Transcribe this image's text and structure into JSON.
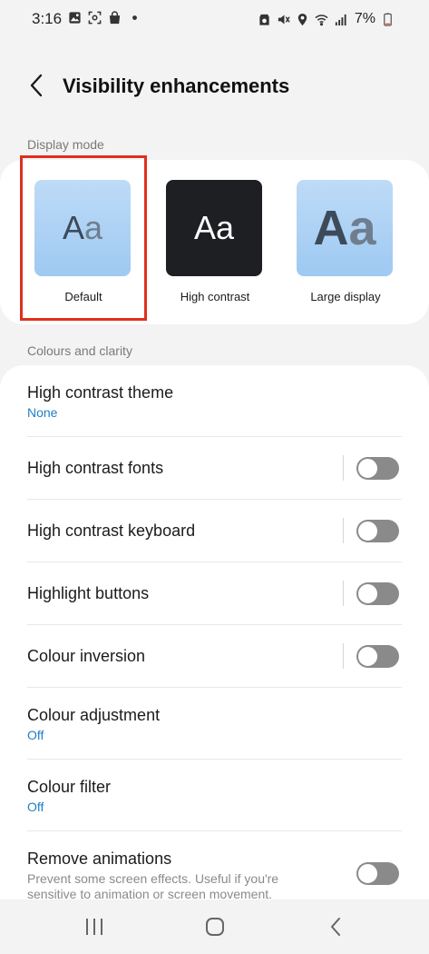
{
  "status_bar": {
    "time": "3:16",
    "battery": "7%",
    "left_icons": [
      "gallery-icon",
      "screenshot-icon",
      "shopping-bag-icon",
      "dot-icon"
    ],
    "right_icons": [
      "data-saver-icon",
      "mute-icon",
      "location-icon",
      "wifi-icon",
      "signal-icon",
      "battery-icon"
    ]
  },
  "header": {
    "title": "Visibility enhancements",
    "back_icon": "chevron-left-icon"
  },
  "display_mode": {
    "section_label": "Display mode",
    "selected": "Default",
    "options": [
      {
        "label": "Default",
        "glyph_upper": "A",
        "glyph_lower": "a"
      },
      {
        "label": "High contrast",
        "glyph_upper": "A",
        "glyph_lower": "a"
      },
      {
        "label": "Large display",
        "glyph_upper": "A",
        "glyph_lower": "a"
      }
    ]
  },
  "colours": {
    "section_label": "Colours and clarity",
    "items": [
      {
        "title": "High contrast theme",
        "subtitle": "None"
      },
      {
        "title": "High contrast fonts",
        "toggle": false
      },
      {
        "title": "High contrast keyboard",
        "toggle": false
      },
      {
        "title": "Highlight buttons",
        "toggle": false
      },
      {
        "title": "Colour inversion",
        "toggle": false
      },
      {
        "title": "Colour adjustment",
        "subtitle": "Off"
      },
      {
        "title": "Colour filter",
        "subtitle": "Off"
      },
      {
        "title": "Remove animations",
        "description": "Prevent some screen effects. Useful if you're sensitive to animation or screen movement.",
        "toggle": false
      }
    ]
  },
  "nav_bar": {
    "icons": [
      "recent-apps-icon",
      "home-icon",
      "back-icon"
    ]
  },
  "colors": {
    "accent_blue": "#1f7ec7",
    "selection_red": "#e02f1f",
    "toggle_off": "#8a8a8a",
    "tile_light_blue": "#a9cff4",
    "tile_dark": "#1d1f22"
  }
}
